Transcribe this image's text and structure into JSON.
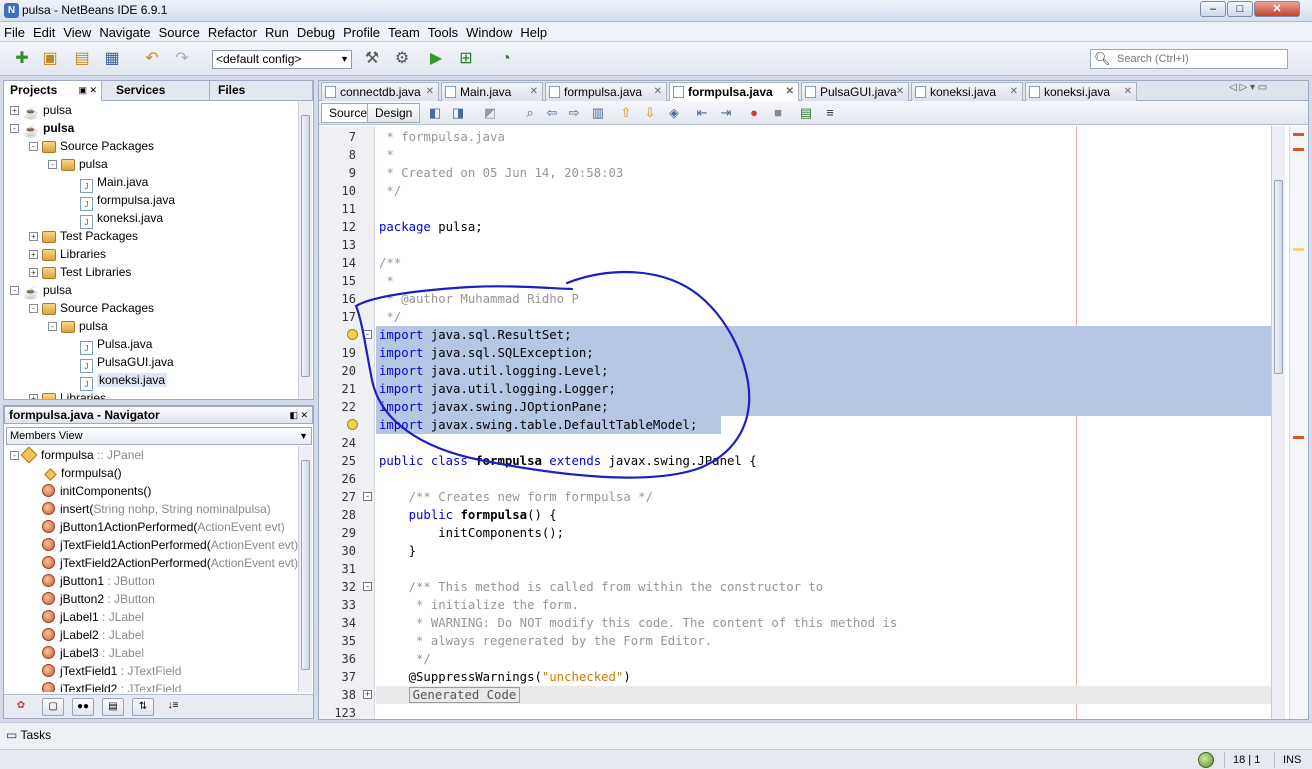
{
  "window": {
    "title": "pulsa - NetBeans IDE 6.9.1",
    "min": "–",
    "max": "□",
    "close": "✕"
  },
  "menu": [
    "File",
    "Edit",
    "View",
    "Navigate",
    "Source",
    "Refactor",
    "Run",
    "Debug",
    "Profile",
    "Team",
    "Tools",
    "Window",
    "Help"
  ],
  "toolbar": {
    "config": "<default config>",
    "search_placeholder": "Search (Ctrl+I)"
  },
  "projects": {
    "tabs": [
      "Projects",
      "Services",
      "Files"
    ],
    "tree": [
      {
        "label": "pulsa",
        "level": 0,
        "type": "project",
        "expander": "+",
        "bold": false
      },
      {
        "label": "pulsa",
        "level": 0,
        "type": "project",
        "expander": "-",
        "bold": true
      },
      {
        "label": "Source Packages",
        "level": 1,
        "type": "package",
        "expander": "-",
        "bold": false
      },
      {
        "label": "pulsa",
        "level": 2,
        "type": "package",
        "expander": "-",
        "bold": false
      },
      {
        "label": "Main.java",
        "level": 3,
        "type": "java",
        "expander": "",
        "bold": false
      },
      {
        "label": "formpulsa.java",
        "level": 3,
        "type": "java-error",
        "expander": "",
        "bold": false
      },
      {
        "label": "koneksi.java",
        "level": 3,
        "type": "java-error",
        "expander": "",
        "bold": false
      },
      {
        "label": "Test Packages",
        "level": 1,
        "type": "package",
        "expander": "+",
        "bold": false
      },
      {
        "label": "Libraries",
        "level": 1,
        "type": "package",
        "expander": "+",
        "bold": false
      },
      {
        "label": "Test Libraries",
        "level": 1,
        "type": "package",
        "expander": "+",
        "bold": false
      },
      {
        "label": "pulsa",
        "level": 0,
        "type": "project",
        "expander": "-",
        "bold": false
      },
      {
        "label": "Source Packages",
        "level": 1,
        "type": "package",
        "expander": "-",
        "bold": false
      },
      {
        "label": "pulsa",
        "level": 2,
        "type": "package",
        "expander": "-",
        "bold": false
      },
      {
        "label": "Pulsa.java",
        "level": 3,
        "type": "java",
        "expander": "",
        "bold": false
      },
      {
        "label": "PulsaGUI.java",
        "level": 3,
        "type": "java",
        "expander": "",
        "bold": false
      },
      {
        "label": "koneksi.java",
        "level": 3,
        "type": "java-selected",
        "expander": "",
        "bold": false
      },
      {
        "label": "Libraries",
        "level": 1,
        "type": "package",
        "expander": "+",
        "bold": false
      }
    ]
  },
  "navigator": {
    "title": "formpulsa.java - Navigator",
    "view": "Members View",
    "items": [
      {
        "name": "formpulsa",
        "type": " :: JPanel",
        "kind": "class"
      },
      {
        "name": "formpulsa()",
        "type": "",
        "kind": "ctor"
      },
      {
        "name": "initComponents()",
        "type": "",
        "kind": "method"
      },
      {
        "name": "insert(",
        "type": "String nohp, String nominalpulsa)",
        "kind": "method"
      },
      {
        "name": "jButton1ActionPerformed(",
        "type": "ActionEvent evt)",
        "kind": "method"
      },
      {
        "name": "jTextField1ActionPerformed(",
        "type": "ActionEvent evt)",
        "kind": "method"
      },
      {
        "name": "jTextField2ActionPerformed(",
        "type": "ActionEvent evt)",
        "kind": "method"
      },
      {
        "name": "jButton1",
        "type": " : JButton",
        "kind": "field"
      },
      {
        "name": "jButton2",
        "type": " : JButton",
        "kind": "field"
      },
      {
        "name": "jLabel1",
        "type": " : JLabel",
        "kind": "field"
      },
      {
        "name": "jLabel2",
        "type": " : JLabel",
        "kind": "field"
      },
      {
        "name": "jLabel3",
        "type": " : JLabel",
        "kind": "field"
      },
      {
        "name": "jTextField1",
        "type": " : JTextField",
        "kind": "field"
      },
      {
        "name": "jTextField2",
        "type": " : JTextField",
        "kind": "field"
      }
    ]
  },
  "editor": {
    "tabs": [
      {
        "label": "connectdb.java",
        "active": false
      },
      {
        "label": "Main.java",
        "active": false
      },
      {
        "label": "formpulsa.java",
        "active": false
      },
      {
        "label": "formpulsa.java",
        "active": true
      },
      {
        "label": "PulsaGUI.java",
        "active": false
      },
      {
        "label": "koneksi.java",
        "active": false
      },
      {
        "label": "koneksi.java",
        "active": false
      }
    ],
    "subtabs": [
      "Source",
      "Design"
    ],
    "lines": [
      {
        "n": "7",
        "html": "<span class='cmt'> * formpulsa.java</span>"
      },
      {
        "n": "8",
        "html": "<span class='cmt'> *</span>"
      },
      {
        "n": "9",
        "html": "<span class='cmt'> * Created on 05 Jun 14, 20:58:03</span>"
      },
      {
        "n": "10",
        "html": "<span class='cmt'> */</span>"
      },
      {
        "n": "11",
        "html": ""
      },
      {
        "n": "12",
        "html": "<span class='kw'>package</span> pulsa;"
      },
      {
        "n": "13",
        "html": ""
      },
      {
        "n": "14",
        "html": "<span class='cmt'>/**</span>"
      },
      {
        "n": "15",
        "html": "<span class='cmt'> *</span>"
      },
      {
        "n": "16",
        "html": "<span class='cmt'> * @author Muhammad Ridho P</span>"
      },
      {
        "n": "17",
        "html": "<span class='cmt'> */</span>"
      },
      {
        "n": "",
        "html": "<span class='kw'>import</span> java.sql.ResultSet;",
        "sel": true,
        "bulb": true,
        "fold": "-"
      },
      {
        "n": "19",
        "html": "<span class='kw'>import</span> java.sql.SQLException;",
        "sel": true
      },
      {
        "n": "20",
        "html": "<span class='kw'>import</span> java.util.logging.Level;",
        "sel": true
      },
      {
        "n": "21",
        "html": "<span class='kw'>import</span> java.util.logging.Logger;",
        "sel": true
      },
      {
        "n": "22",
        "html": "<span class='kw'>import</span> javax.swing.JOptionPane;",
        "sel": true
      },
      {
        "n": "",
        "html": "<span class='kw'>import</span> javax.swing.table.DefaultTableModel;",
        "sel": "partial",
        "bulb": true
      },
      {
        "n": "24",
        "html": ""
      },
      {
        "n": "25",
        "html": "<span class='kw'>public class</span> <b>formpulsa</b> <span class='kw'>extends</span> javax.swing.JPanel {"
      },
      {
        "n": "26",
        "html": ""
      },
      {
        "n": "27",
        "html": "    <span class='cmt'>/** Creates new form formpulsa */</span>",
        "fold": "-"
      },
      {
        "n": "28",
        "html": "    <span class='kw'>public</span> <b>formpulsa</b>() {"
      },
      {
        "n": "29",
        "html": "        initComponents();"
      },
      {
        "n": "30",
        "html": "    }"
      },
      {
        "n": "31",
        "html": ""
      },
      {
        "n": "32",
        "html": "    <span class='cmt'>/** This method is called from within the constructor to</span>",
        "fold": "-"
      },
      {
        "n": "33",
        "html": "<span class='cmt'>     * initialize the form.</span>"
      },
      {
        "n": "34",
        "html": "<span class='cmt'>     * WARNING: Do NOT modify this code. The content of this method is</span>"
      },
      {
        "n": "35",
        "html": "<span class='cmt'>     * always regenerated by the Form Editor.</span>"
      },
      {
        "n": "36",
        "html": "<span class='cmt'>     */</span>"
      },
      {
        "n": "37",
        "html": "    @SuppressWarnings(<span class='str'>\"unchecked\"</span>)"
      },
      {
        "n": "38",
        "html": "    <span class='gencode'>Generated Code</span>",
        "fold": "+",
        "gray": true
      },
      {
        "n": "123",
        "html": ""
      }
    ]
  },
  "status": {
    "tasks": "Tasks",
    "position": "18 | 1",
    "mode": "INS"
  },
  "annotation_color": "#1b1fc4"
}
